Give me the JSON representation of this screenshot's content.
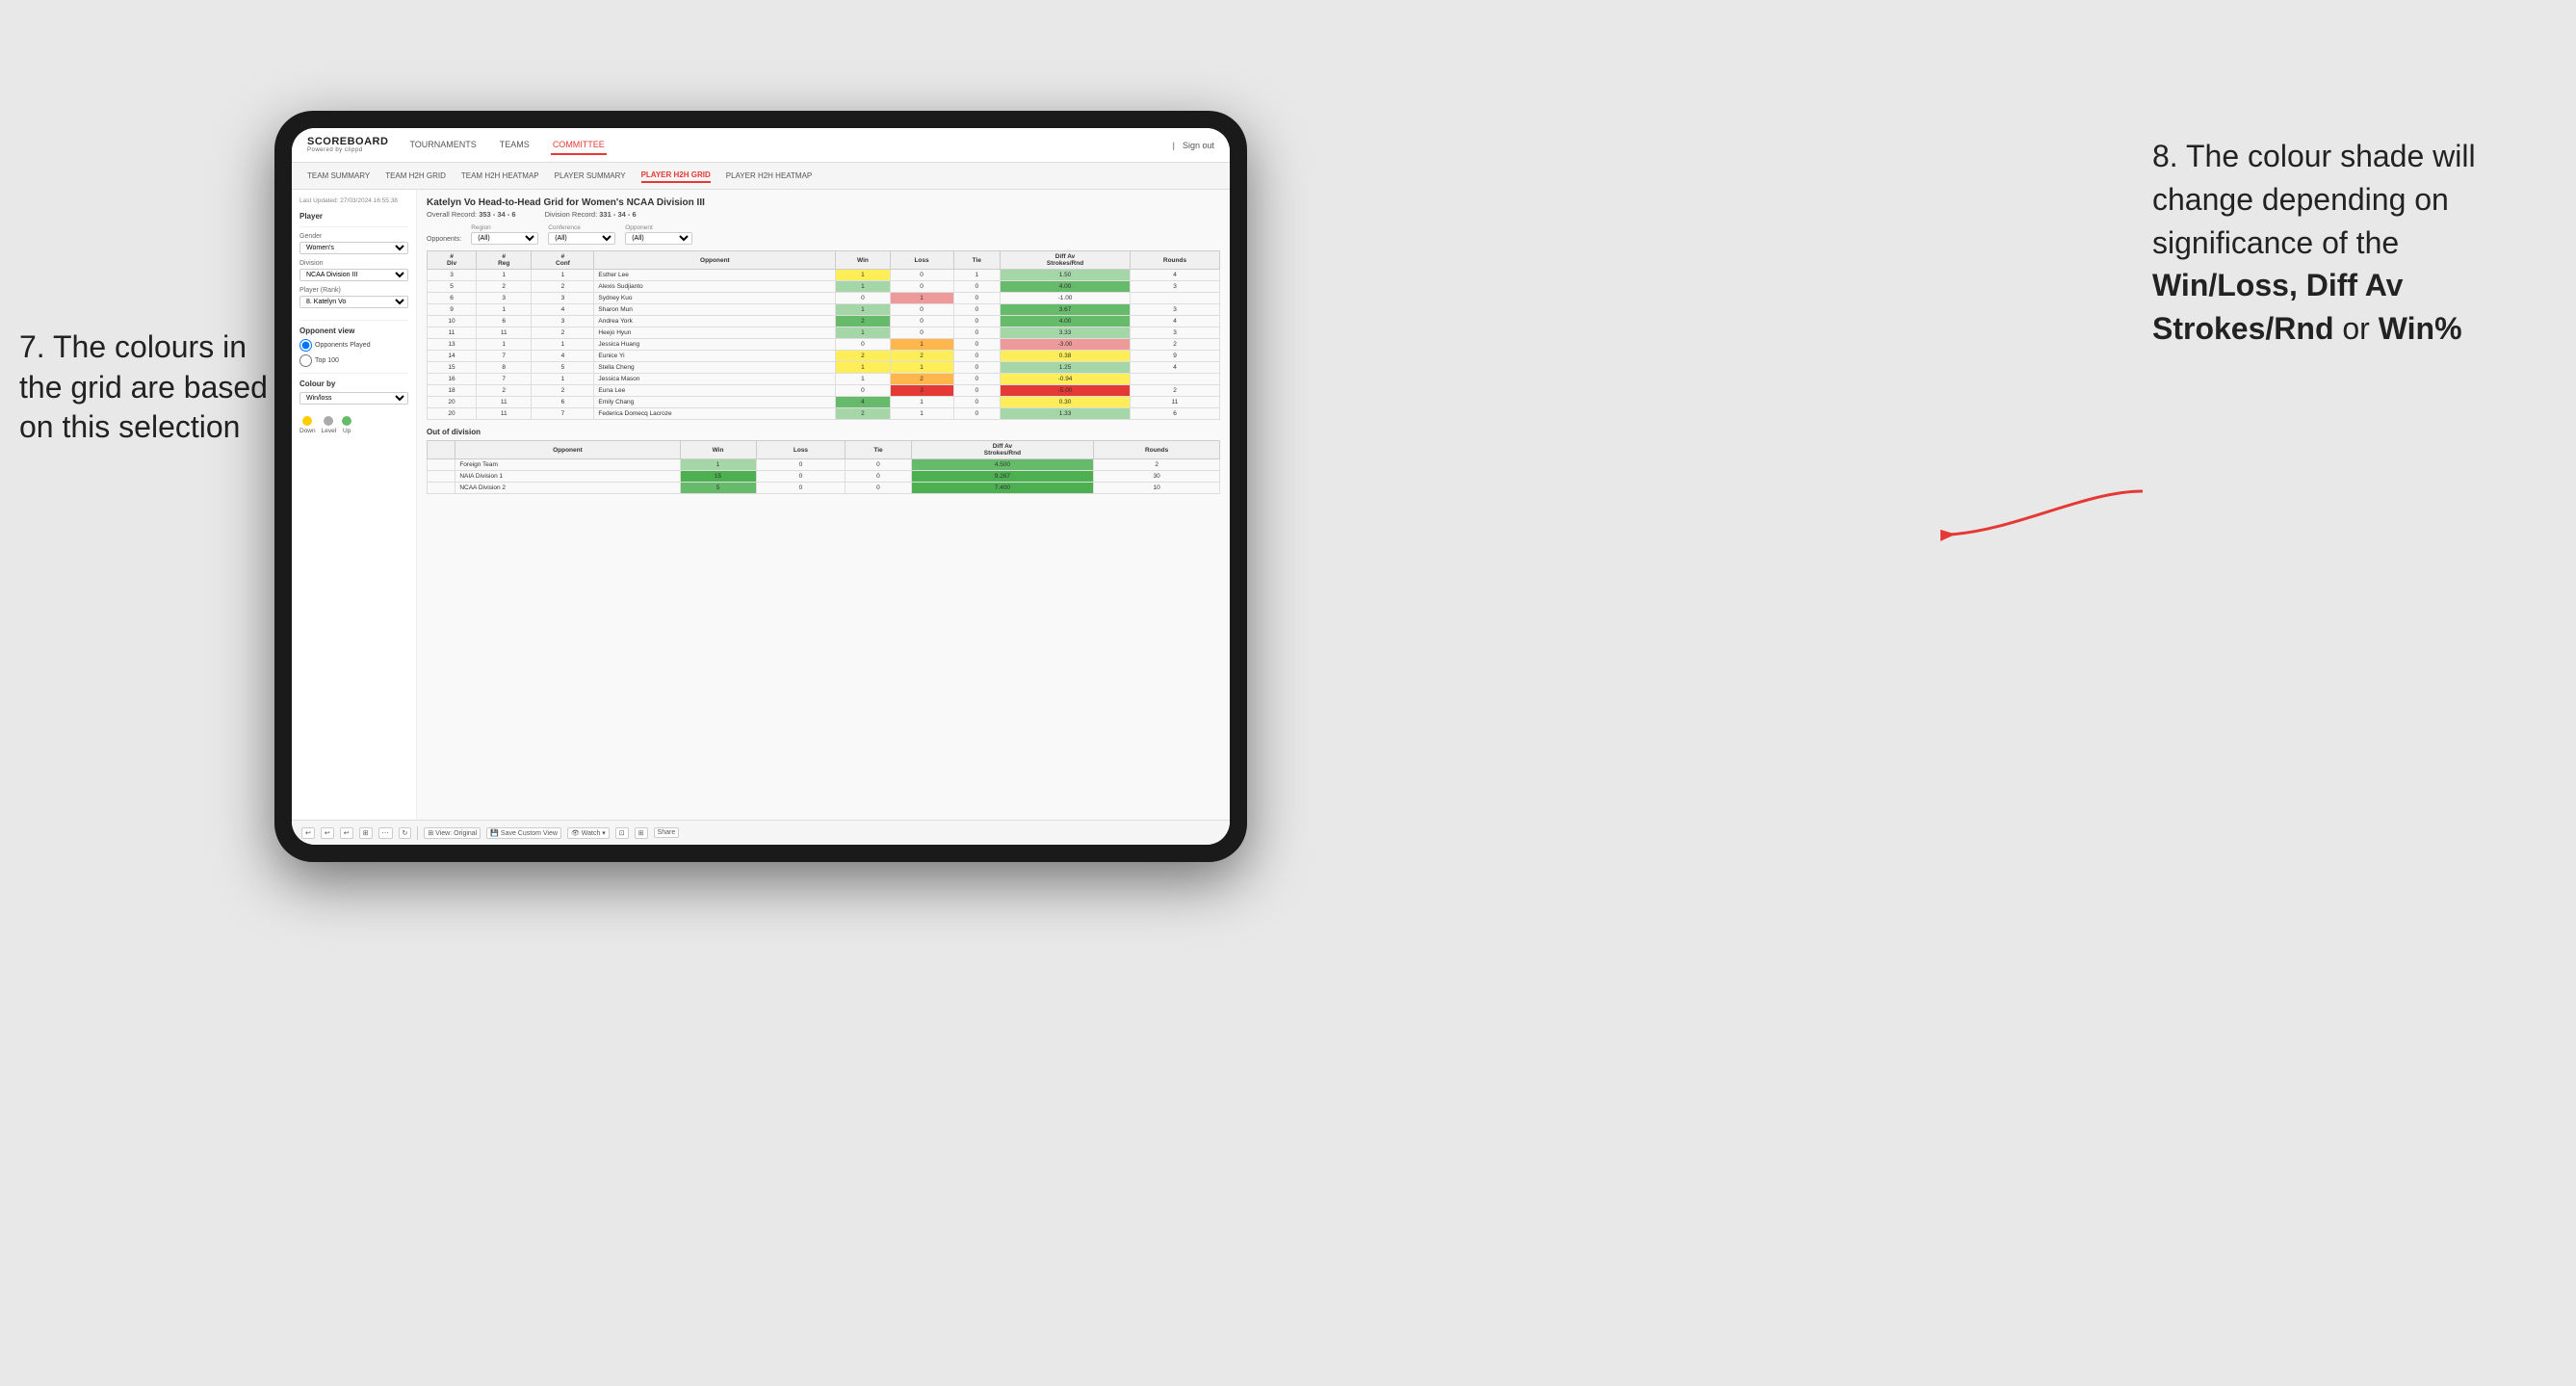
{
  "annotations": {
    "left_title": "7. The colours in the grid are based on this selection",
    "right_title": "8. The colour shade will change depending on significance of the",
    "right_bold1": "Win/Loss,",
    "right_bold2": "Diff Av Strokes/Rnd",
    "right_text": "or",
    "right_bold3": "Win%"
  },
  "nav": {
    "logo": "SCOREBOARD",
    "logo_sub": "Powered by clippd",
    "links": [
      "TOURNAMENTS",
      "TEAMS",
      "COMMITTEE"
    ],
    "active_link": "COMMITTEE",
    "sign_in": "Sign out"
  },
  "sub_nav": {
    "links": [
      "TEAM SUMMARY",
      "TEAM H2H GRID",
      "TEAM H2H HEATMAP",
      "PLAYER SUMMARY",
      "PLAYER H2H GRID",
      "PLAYER H2H HEATMAP"
    ],
    "active": "PLAYER H2H GRID"
  },
  "sidebar": {
    "timestamp": "Last Updated: 27/03/2024 16:55:38",
    "player_label": "Player",
    "gender_label": "Gender",
    "gender_value": "Women's",
    "division_label": "Division",
    "division_value": "NCAA Division III",
    "player_rank_label": "Player (Rank)",
    "player_rank_value": "8. Katelyn Vo",
    "opponent_view_label": "Opponent view",
    "radio1": "Opponents Played",
    "radio2": "Top 100",
    "colour_by_label": "Colour by",
    "colour_by_value": "Win/loss",
    "legend_down": "Down",
    "legend_level": "Level",
    "legend_up": "Up",
    "legend_colors": [
      "#ffcc00",
      "#aaaaaa",
      "#66bb6a"
    ]
  },
  "grid": {
    "title": "Katelyn Vo Head-to-Head Grid for Women's NCAA Division III",
    "overall_record_label": "Overall Record:",
    "overall_record": "353 - 34 - 6",
    "division_record_label": "Division Record:",
    "division_record": "331 - 34 - 6",
    "filter_opponents_label": "Opponents:",
    "filter_region_label": "Region",
    "filter_region_value": "(All)",
    "filter_conference_label": "Conference",
    "filter_conference_value": "(All)",
    "filter_opponent_label": "Opponent",
    "filter_opponent_value": "(All)",
    "table_headers": [
      "#\nDiv",
      "#\nReg",
      "#\nConf",
      "Opponent",
      "Win",
      "Loss",
      "Tie",
      "Diff Av\nStrokes/Rnd",
      "Rounds"
    ],
    "rows": [
      {
        "div": "3",
        "reg": "1",
        "conf": "1",
        "opponent": "Esther Lee",
        "win": "1",
        "loss": "0",
        "tie": "1",
        "diff": "1.50",
        "rounds": "4",
        "win_color": "yellow",
        "loss_color": "",
        "diff_color": "green-light"
      },
      {
        "div": "5",
        "reg": "2",
        "conf": "2",
        "opponent": "Alexis Sudjianto",
        "win": "1",
        "loss": "0",
        "tie": "0",
        "diff": "4.00",
        "rounds": "3",
        "win_color": "green-light",
        "diff_color": "green-medium"
      },
      {
        "div": "6",
        "reg": "3",
        "conf": "3",
        "opponent": "Sydney Kuo",
        "win": "0",
        "loss": "1",
        "tie": "0",
        "diff": "-1.00",
        "rounds": "",
        "win_color": "",
        "loss_color": "red-light",
        "diff_color": ""
      },
      {
        "div": "9",
        "reg": "1",
        "conf": "4",
        "opponent": "Sharon Mun",
        "win": "1",
        "loss": "0",
        "tie": "0",
        "diff": "3.67",
        "rounds": "3",
        "win_color": "green-light",
        "diff_color": "green-medium"
      },
      {
        "div": "10",
        "reg": "6",
        "conf": "3",
        "opponent": "Andrea York",
        "win": "2",
        "loss": "0",
        "tie": "0",
        "diff": "4.00",
        "rounds": "4",
        "win_color": "green-medium",
        "diff_color": "green-medium"
      },
      {
        "div": "11",
        "reg": "11",
        "conf": "2",
        "opponent": "Heejo Hyun",
        "win": "1",
        "loss": "0",
        "tie": "0",
        "diff": "3.33",
        "rounds": "3",
        "win_color": "green-light",
        "diff_color": "green-light"
      },
      {
        "div": "13",
        "reg": "1",
        "conf": "1",
        "opponent": "Jessica Huang",
        "win": "0",
        "loss": "1",
        "tie": "0",
        "diff": "-3.00",
        "rounds": "2",
        "win_color": "",
        "loss_color": "orange",
        "diff_color": "red-light"
      },
      {
        "div": "14",
        "reg": "7",
        "conf": "4",
        "opponent": "Eunice Yi",
        "win": "2",
        "loss": "2",
        "tie": "0",
        "diff": "0.38",
        "rounds": "9",
        "win_color": "yellow",
        "diff_color": "yellow"
      },
      {
        "div": "15",
        "reg": "8",
        "conf": "5",
        "opponent": "Stella Cheng",
        "win": "1",
        "loss": "1",
        "tie": "0",
        "diff": "1.25",
        "rounds": "4",
        "win_color": "yellow",
        "diff_color": "green-light"
      },
      {
        "div": "16",
        "reg": "7",
        "conf": "1",
        "opponent": "Jessica Mason",
        "win": "1",
        "loss": "2",
        "tie": "0",
        "diff": "-0.94",
        "rounds": "",
        "win_color": "",
        "loss_color": "orange",
        "diff_color": "yellow"
      },
      {
        "div": "18",
        "reg": "2",
        "conf": "2",
        "opponent": "Euna Lee",
        "win": "0",
        "loss": "3",
        "tie": "0",
        "diff": "-5.00",
        "rounds": "2",
        "win_color": "",
        "loss_color": "red-dark",
        "diff_color": "red-dark"
      },
      {
        "div": "20",
        "reg": "11",
        "conf": "6",
        "opponent": "Emily Chang",
        "win": "4",
        "loss": "1",
        "tie": "0",
        "diff": "0.30",
        "rounds": "11",
        "win_color": "green-medium",
        "diff_color": "yellow"
      },
      {
        "div": "20",
        "reg": "11",
        "conf": "7",
        "opponent": "Federica Domecq Lacroze",
        "win": "2",
        "loss": "1",
        "tie": "0",
        "diff": "1.33",
        "rounds": "6",
        "win_color": "green-light",
        "diff_color": "green-light"
      }
    ],
    "out_of_division_title": "Out of division",
    "out_of_division_rows": [
      {
        "opponent": "Foreign Team",
        "win": "1",
        "loss": "0",
        "tie": "0",
        "diff": "4.500",
        "rounds": "2",
        "win_color": "green-light",
        "diff_color": "green-medium"
      },
      {
        "opponent": "NAIA Division 1",
        "win": "15",
        "loss": "0",
        "tie": "0",
        "diff": "9.267",
        "rounds": "30",
        "win_color": "green-dark",
        "diff_color": "green-dark"
      },
      {
        "opponent": "NCAA Division 2",
        "win": "5",
        "loss": "0",
        "tie": "0",
        "diff": "7.400",
        "rounds": "10",
        "win_color": "green-medium",
        "diff_color": "green-dark"
      }
    ]
  },
  "toolbar": {
    "buttons": [
      "↩",
      "↩",
      "↩",
      "⊞",
      "⋯",
      "↻",
      "|",
      "⊞ View: Original",
      "💾 Save Custom View",
      "👁 Watch ▾",
      "⊡",
      "⊞",
      "Share"
    ]
  }
}
